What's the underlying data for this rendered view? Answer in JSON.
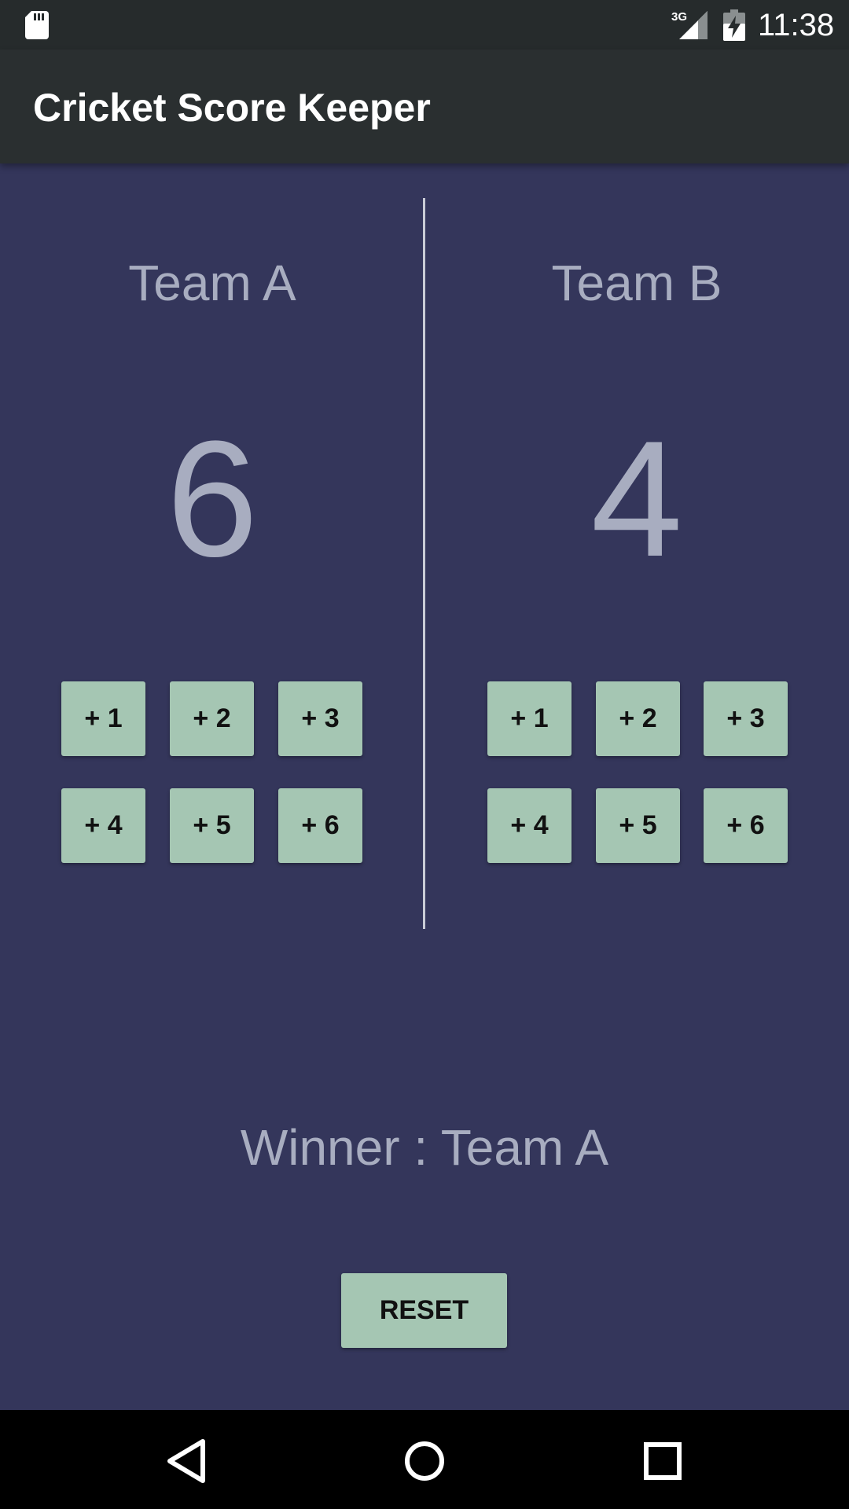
{
  "status_bar": {
    "time": "11:38",
    "network": "3G",
    "icons": [
      "sd-card-icon",
      "signal-icon",
      "battery-charging-icon"
    ]
  },
  "app_bar": {
    "title": "Cricket Score Keeper"
  },
  "team_a": {
    "name": "Team A",
    "score": "6",
    "buttons": [
      "+ 1",
      "+ 2",
      "+ 3",
      "+ 4",
      "+ 5",
      "+ 6"
    ]
  },
  "team_b": {
    "name": "Team B",
    "score": "4",
    "buttons": [
      "+ 1",
      "+ 2",
      "+ 3",
      "+ 4",
      "+ 5",
      "+ 6"
    ]
  },
  "winner": "Winner : Team A",
  "reset_label": "RESET",
  "nav_bar": {
    "icons": [
      "back-icon",
      "home-icon",
      "recents-icon"
    ]
  },
  "colors": {
    "background": "#34365b",
    "app_bar": "#2a2f30",
    "status_bar": "#262b2c",
    "button": "#a5c6b3",
    "text_muted": "#a8adc0"
  }
}
